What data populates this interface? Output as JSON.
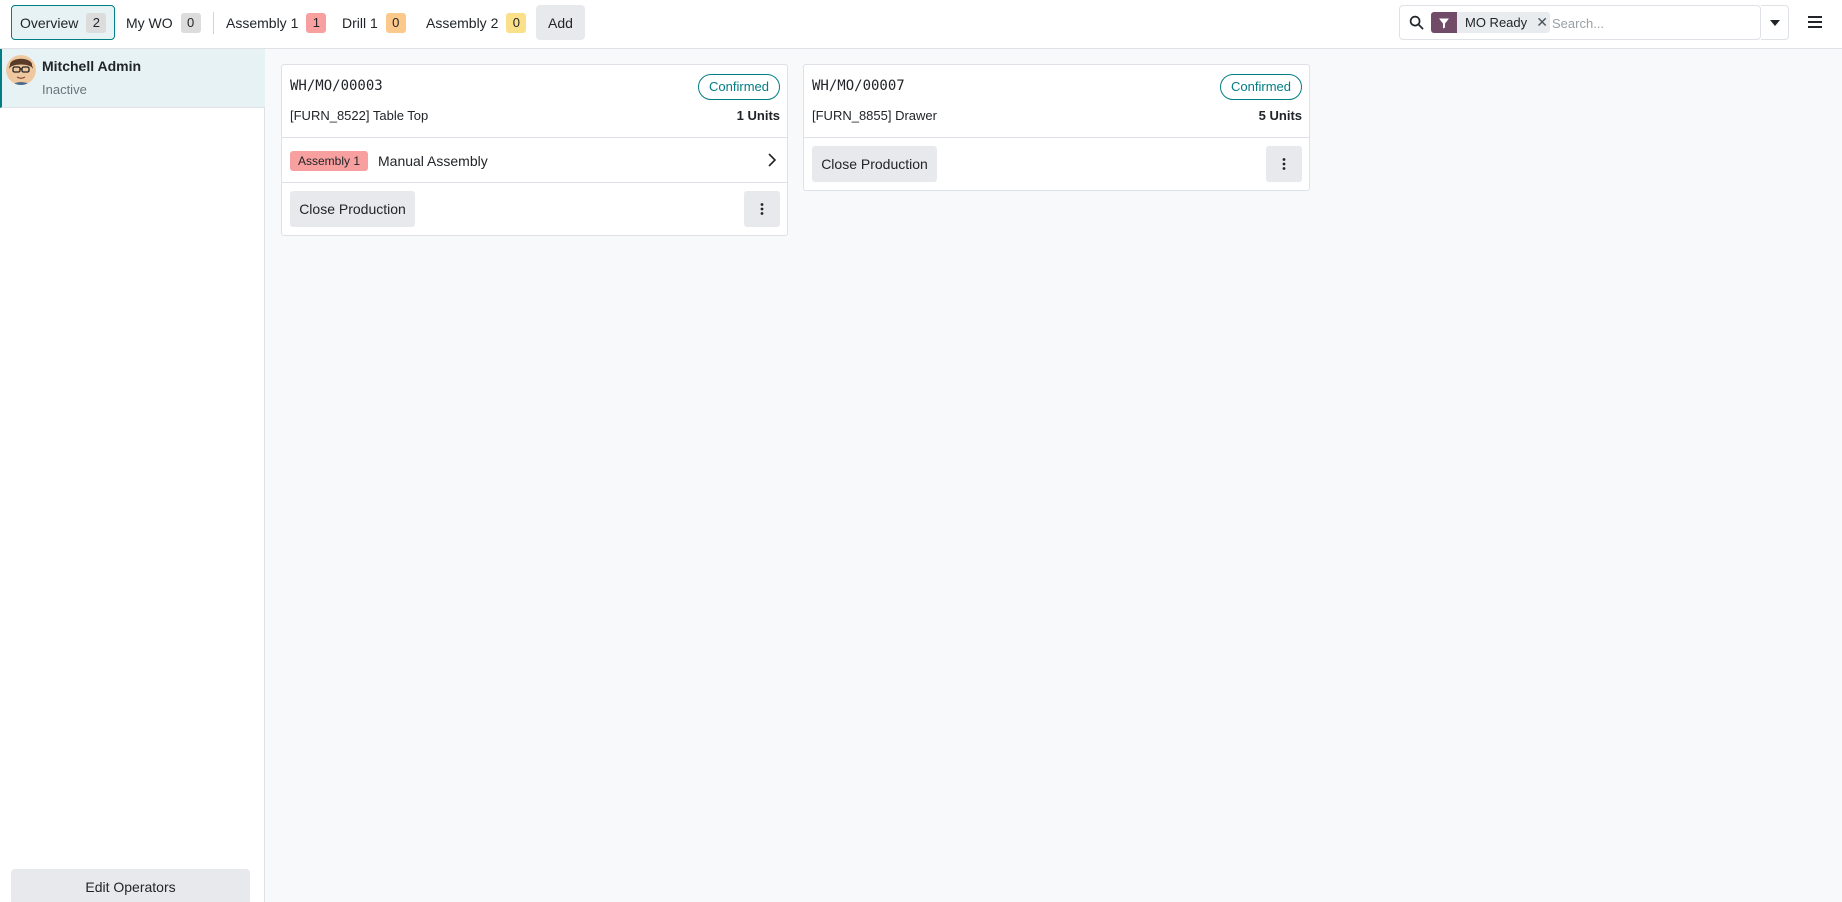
{
  "tabs": [
    {
      "label": "Overview",
      "count": "2"
    },
    {
      "label": "My WO",
      "count": "0"
    },
    {
      "label": "Assembly 1",
      "count": "1"
    },
    {
      "label": "Drill 1",
      "count": "0"
    },
    {
      "label": "Assembly 2",
      "count": "0"
    }
  ],
  "add_label": "Add",
  "search": {
    "facet_label": "MO Ready",
    "facet_icon": "filter-icon",
    "placeholder": "Search..."
  },
  "sidebar": {
    "operator_name": "Mitchell Admin",
    "operator_status": "Inactive",
    "edit_label": "Edit Operators"
  },
  "cards": [
    {
      "title": "WH/MO/00003",
      "status": "Confirmed",
      "product": "[FURN_8522] Table Top",
      "quantity": "1 Units",
      "workorder": {
        "workcenter": "Assembly 1",
        "name": "Manual Assembly"
      },
      "close_label": "Close Production"
    },
    {
      "title": "WH/MO/00007",
      "status": "Confirmed",
      "product": "[FURN_8855] Drawer",
      "quantity": "5 Units",
      "close_label": "Close Production"
    }
  ],
  "colors": {
    "accent": "#017e84",
    "facet_bg": "#714b67",
    "badge_red": "#f8a0a0",
    "badge_orange": "#fbc98b",
    "badge_yellow": "#fbe08a"
  }
}
